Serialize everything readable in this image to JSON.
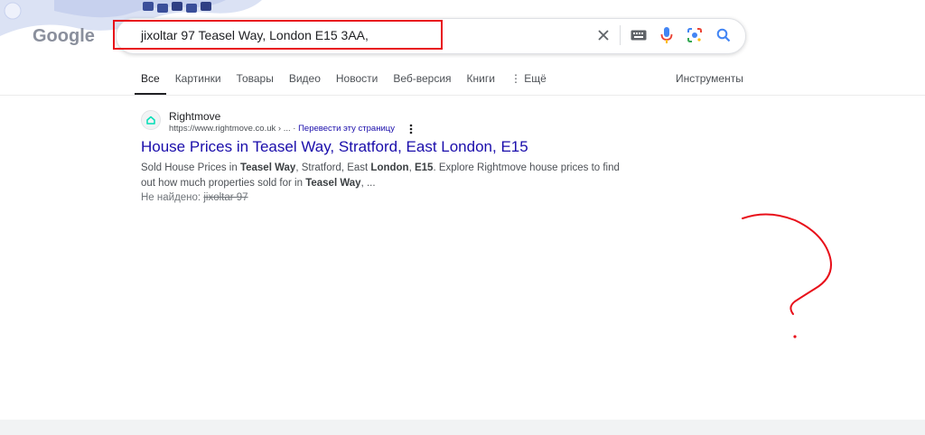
{
  "logo": {
    "text": "Google"
  },
  "search": {
    "query": "jixoltar 97 Teasel Way, London E15 3AA,",
    "icons": [
      "close-icon",
      "keyboard-icon",
      "mic-icon",
      "lens-icon",
      "search-icon"
    ]
  },
  "tabs": [
    {
      "label": "Все",
      "active": true
    },
    {
      "label": "Картинки"
    },
    {
      "label": "Товары"
    },
    {
      "label": "Видео"
    },
    {
      "label": "Новости"
    },
    {
      "label": "Веб-версия"
    },
    {
      "label": "Книги"
    },
    {
      "label": "Ещё"
    }
  ],
  "tools_label": "Инструменты",
  "result": {
    "site_name": "Rightmove",
    "url": "https://www.rightmove.co.uk › ...",
    "translate": "Перевести эту страницу",
    "title": "House Prices in Teasel Way, Stratford, East London, E15",
    "snippet_parts": [
      {
        "t": "Sold House Prices in ",
        "b": false
      },
      {
        "t": "Teasel Way",
        "b": true
      },
      {
        "t": ", Stratford, East ",
        "b": false
      },
      {
        "t": "London",
        "b": true
      },
      {
        "t": ", ",
        "b": false
      },
      {
        "t": "E15",
        "b": true
      },
      {
        "t": ". Explore Rightmove house prices to find out how much properties sold for in ",
        "b": false
      },
      {
        "t": "Teasel Way",
        "b": true
      },
      {
        "t": ", ...",
        "b": false
      }
    ],
    "missing_label": "Не найдено:",
    "missing_term": "jixoltar 97"
  },
  "colors": {
    "link": "#1a0dab",
    "annotation_red": "#e8101a"
  }
}
